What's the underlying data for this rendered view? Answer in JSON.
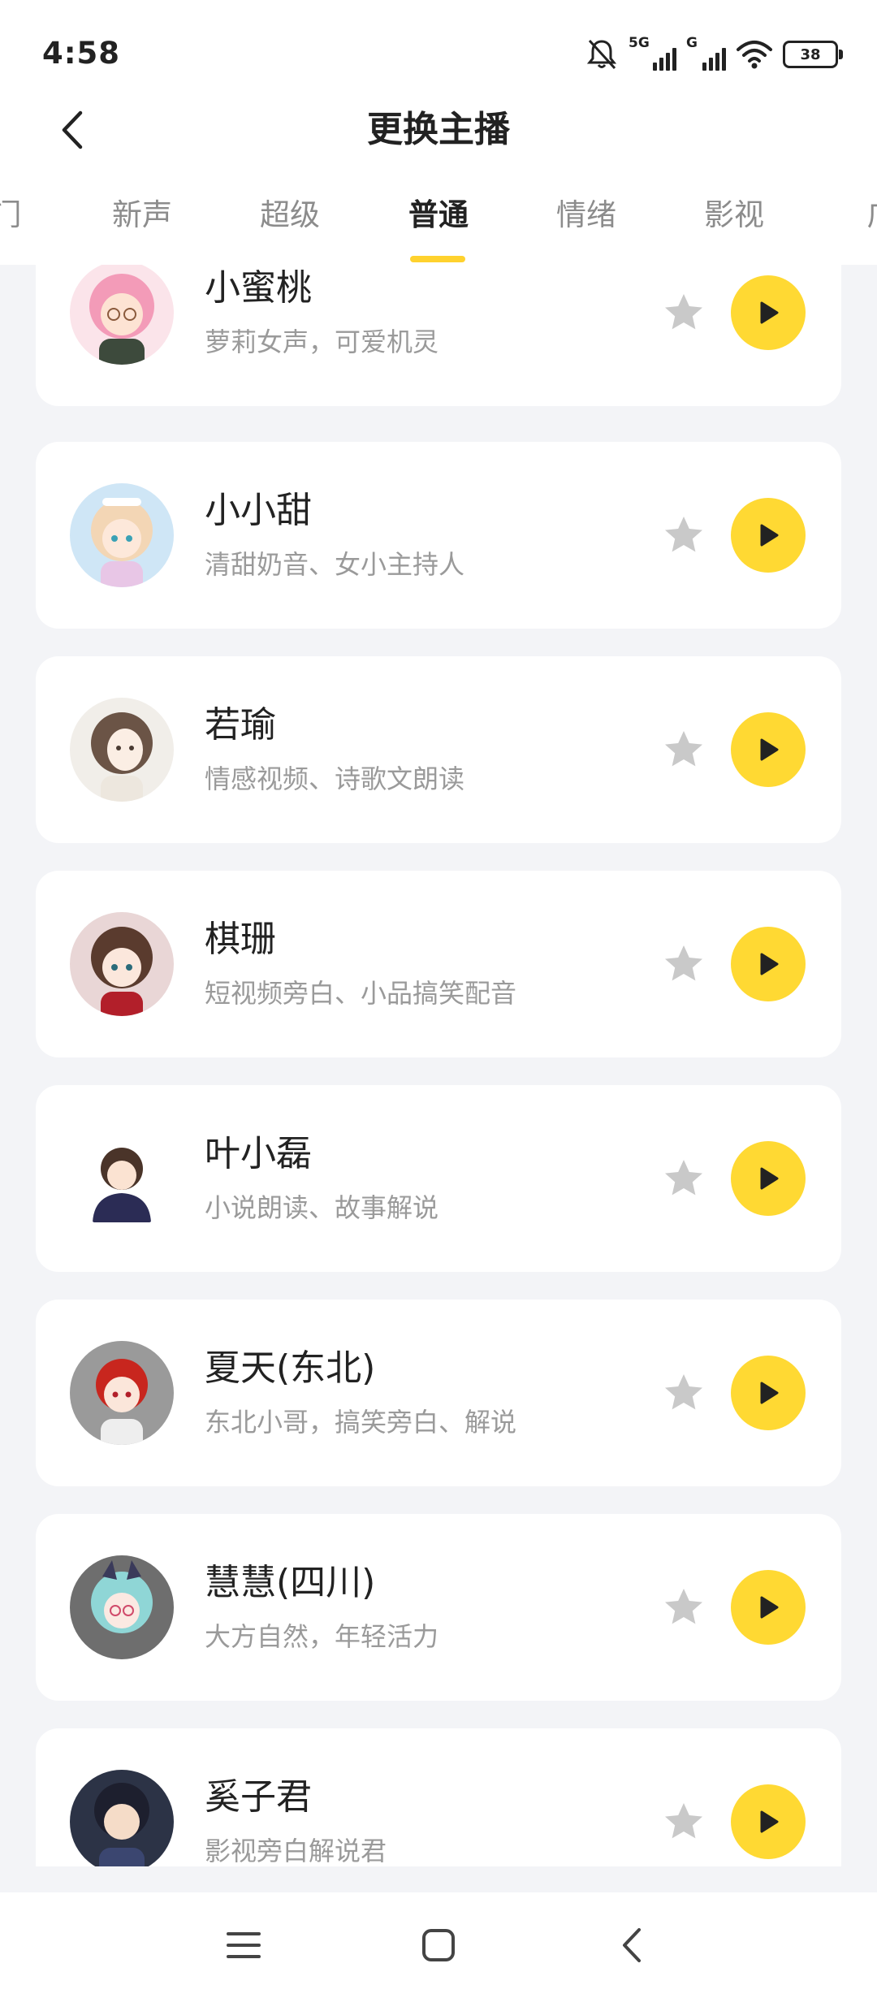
{
  "status_bar": {
    "time": "4:58",
    "network_1": "5G",
    "network_2": "G",
    "battery": "38"
  },
  "header": {
    "title": "更换主播"
  },
  "tabs": [
    {
      "label": "门"
    },
    {
      "label": "新声"
    },
    {
      "label": "超级"
    },
    {
      "label": "普通",
      "active": true
    },
    {
      "label": "情绪"
    },
    {
      "label": "影视"
    },
    {
      "label": "广"
    }
  ],
  "anchors": [
    {
      "name": "小蜜桃",
      "desc": "萝莉女声，可爱机灵"
    },
    {
      "name": "小小甜",
      "desc": "清甜奶音、女小主持人"
    },
    {
      "name": "若瑜",
      "desc": "情感视频、诗歌文朗读"
    },
    {
      "name": "棋珊",
      "desc": "短视频旁白、小品搞笑配音"
    },
    {
      "name": "叶小磊",
      "desc": "小说朗读、故事解说"
    },
    {
      "name": "夏天(东北)",
      "desc": "东北小哥，搞笑旁白、解说"
    },
    {
      "name": "慧慧(四川)",
      "desc": "大方自然，年轻活力"
    },
    {
      "name": "奚子君",
      "desc": "影视旁白解说君"
    }
  ],
  "colors": {
    "accent_yellow": "#ffd933",
    "tab_indicator": "#ffd22e",
    "star_gray": "#c9c9c9",
    "page_bg": "#f3f4f7"
  },
  "icons": {
    "back": "chevron-left-icon",
    "favorite": "star-icon",
    "play": "play-icon",
    "nav_menu": "menu-icon",
    "nav_home": "square-icon",
    "nav_back": "chevron-left-icon"
  }
}
